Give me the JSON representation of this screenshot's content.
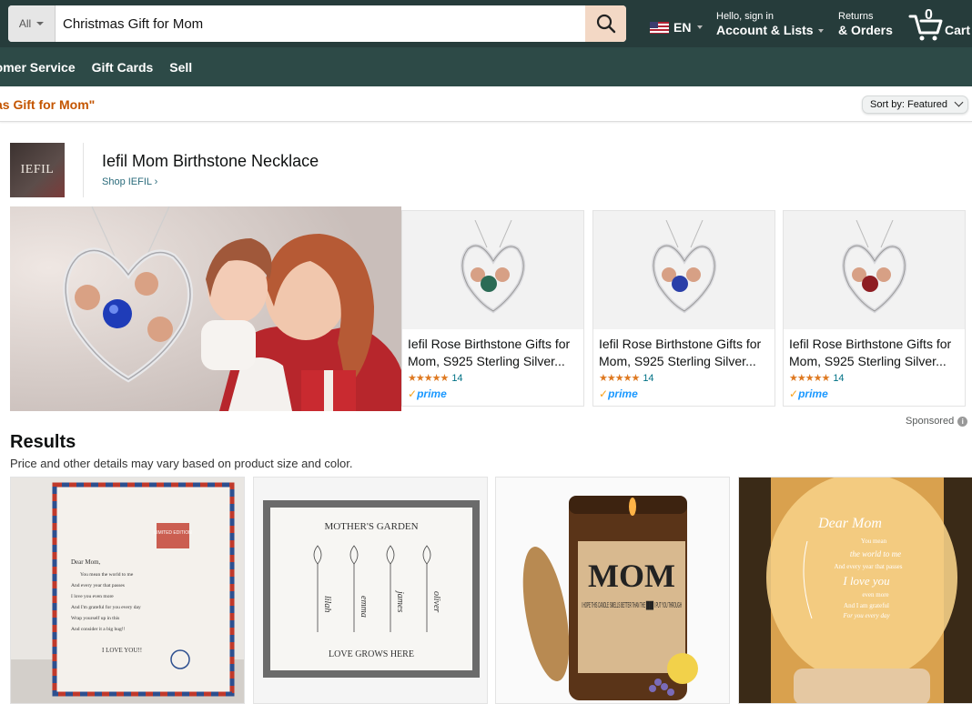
{
  "search": {
    "category": "All",
    "query": "Christmas Gift for Mom"
  },
  "header": {
    "language": "EN",
    "account_line1": "Hello, sign in",
    "account_line2": "Account & Lists",
    "orders_line1": "Returns",
    "orders_line2": "& Orders",
    "cart_count": "0",
    "cart_label": "Cart"
  },
  "subnav": [
    "tomer Service",
    "Gift Cards",
    "Sell"
  ],
  "results_query": "as Gift for Mom\"",
  "sort": {
    "label": "Sort by:",
    "value": "Featured"
  },
  "brand": {
    "logo_text": "IEFIL",
    "title": "Iefil Mom Birthstone Necklace",
    "shop_link": "Shop IEFIL ›"
  },
  "sponsored_products": [
    {
      "title": "Iefil Rose Birthstone Gifts for Mom, S925 Sterling Silver...",
      "rating_count": "14",
      "stars": "★★★★★",
      "gem_color": "#2b6b55",
      "prime": "prime"
    },
    {
      "title": "Iefil Rose Birthstone Gifts for Mom, S925 Sterling Silver...",
      "rating_count": "14",
      "stars": "★★★★★",
      "gem_color": "#2a3fa8",
      "prime": "prime"
    },
    {
      "title": "Iefil Rose Birthstone Gifts for Mom, S925 Sterling Silver...",
      "rating_count": "14",
      "stars": "★★★★★",
      "gem_color": "#8e1d23",
      "prime": "prime"
    }
  ],
  "sponsored_label": "Sponsored",
  "results": {
    "heading": "Results",
    "subtitle": "Price and other details may vary based on product size and color."
  },
  "result_tiles": {
    "blanket": {
      "greeting": "Dear Mom,",
      "lines": [
        "You mean the world to me",
        "And every year that passes",
        "I love you even more",
        "And I'm grateful for you every day",
        "Wrap yourself up in this",
        "And consider it a big hug!!"
      ],
      "closing": "I LOVE YOU!!",
      "badge": "LIMITED EDITION"
    },
    "garden": {
      "title": "MOTHER'S GARDEN",
      "names": [
        "lilah",
        "emma",
        "james",
        "oliver"
      ],
      "footer": "LOVE GROWS HERE"
    },
    "candle": {
      "mom": "MOM",
      "text": "I HOPE THIS CANDLE SMELLS BETTER THAN THE ████ I PUT YOU THROUGH"
    },
    "lamp": {
      "title": "Dear Mom",
      "lines": [
        "You mean",
        "the world to me",
        "And every year that passes",
        "I love you",
        "even more",
        "And I am grateful",
        "For you every day"
      ]
    }
  }
}
